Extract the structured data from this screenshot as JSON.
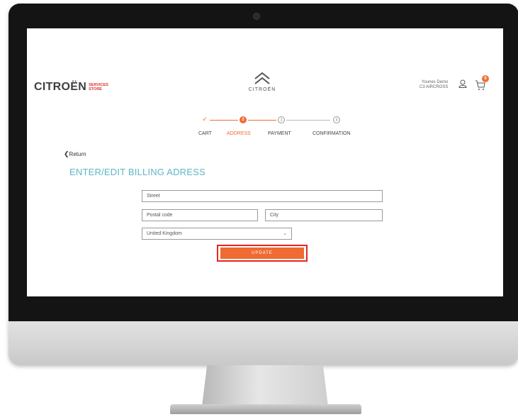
{
  "brand": {
    "name": "CITROËN",
    "services_line1": "SERVICES",
    "services_line2": "STORE",
    "center_logo_text": "CITROËN"
  },
  "user": {
    "name": "Younes Demo",
    "car": "C3 AIRCROSS",
    "cart_count": "0"
  },
  "steps": [
    {
      "number": "✓",
      "label": "CART",
      "state": "done"
    },
    {
      "number": "2",
      "label": "ADDRESS",
      "state": "active"
    },
    {
      "number": "3",
      "label": "PAYMENT",
      "state": "todo"
    },
    {
      "number": "4",
      "label": "CONFIRMATION",
      "state": "todo"
    }
  ],
  "nav": {
    "return_label": "Return"
  },
  "form": {
    "title": "ENTER/EDIT BILLING ADRESS",
    "street_placeholder": "Street",
    "postal_placeholder": "Postal code",
    "city_placeholder": "City",
    "country_value": "United Kingdom",
    "update_label": "UPDATE"
  },
  "colors": {
    "accent": "#f06a32",
    "title": "#5fb5c7",
    "highlight": "#e8241f",
    "brand_red": "#e0302f"
  }
}
